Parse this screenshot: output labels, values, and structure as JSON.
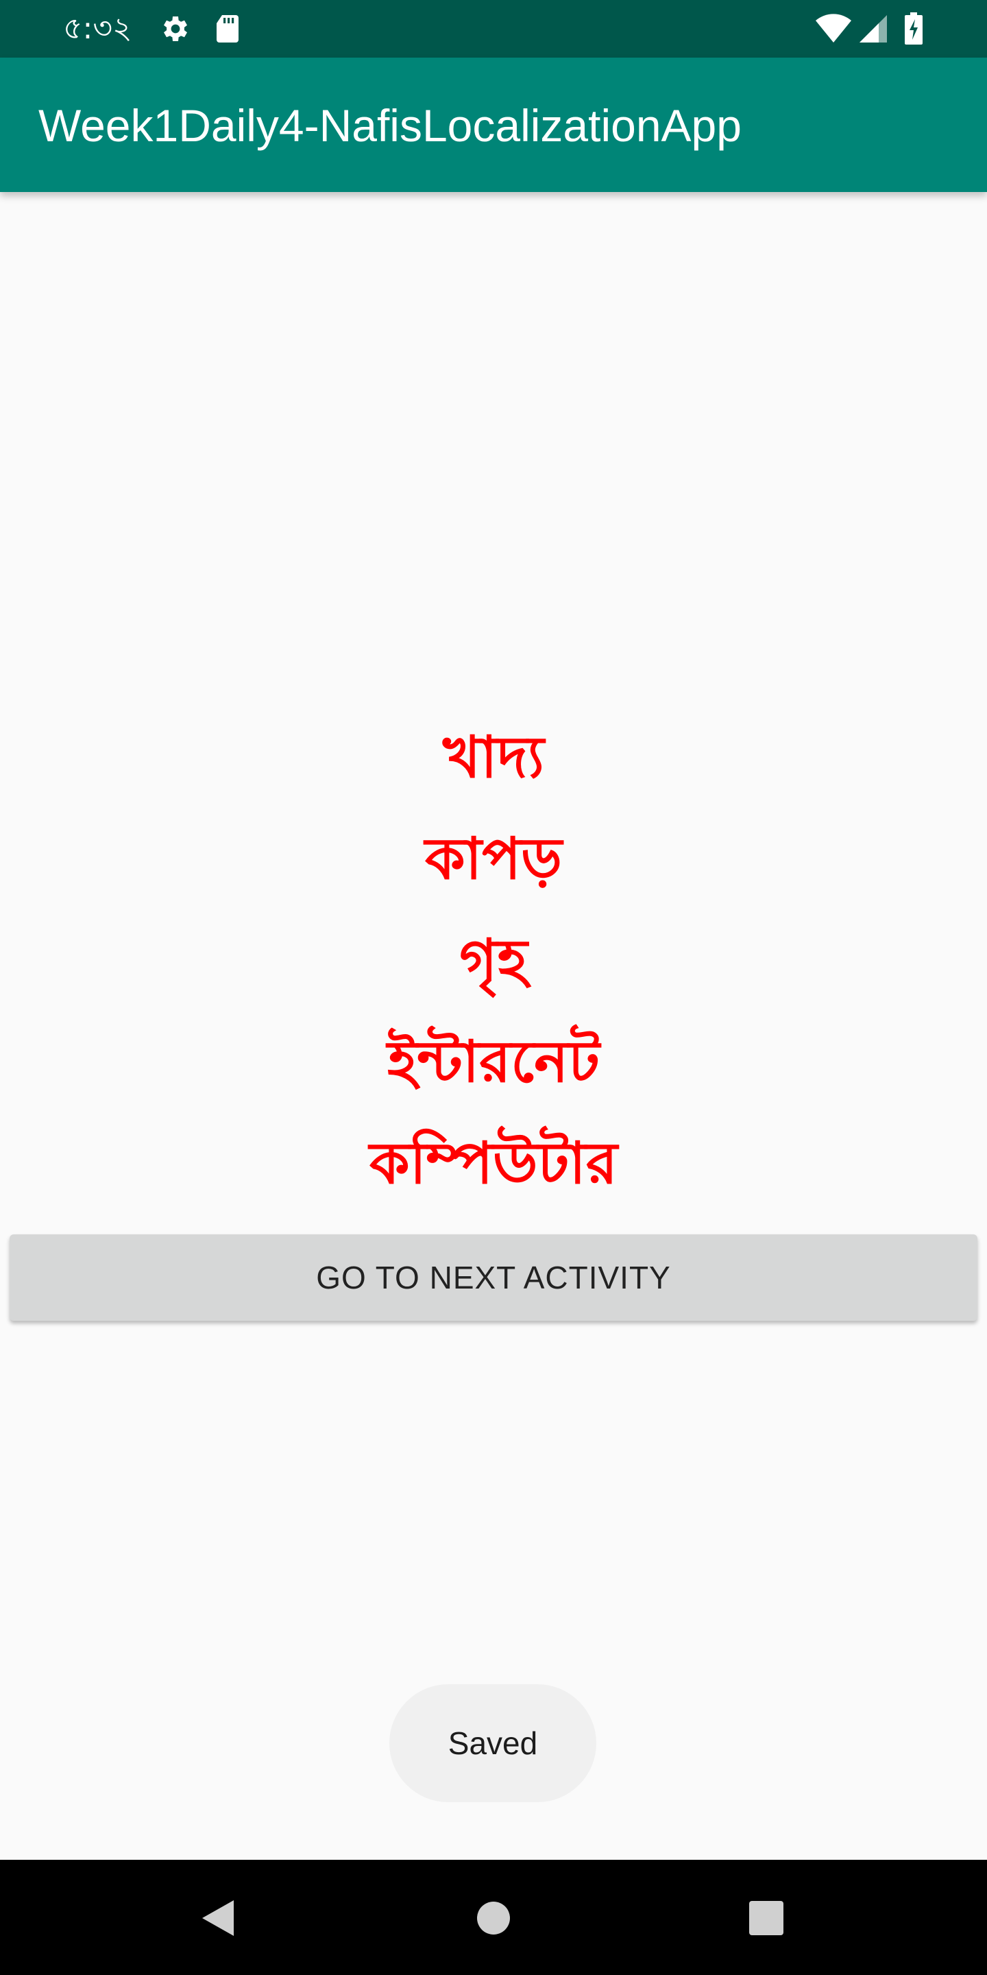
{
  "status_bar": {
    "time": "৫:৩২",
    "icons": [
      "settings-icon",
      "sd-card-icon",
      "wifi-icon",
      "signal-icon",
      "battery-charging-icon"
    ]
  },
  "app_bar": {
    "title": "Week1Daily4-NafisLocalizationApp"
  },
  "main": {
    "words": [
      "খাদ্য",
      "কাপড়",
      "গৃহ",
      "ইন্টারনেট",
      "কম্পিউটার"
    ],
    "next_button_label": "GO TO NEXT ACTIVITY"
  },
  "toast": {
    "message": "Saved"
  },
  "nav_bar": {
    "icons": [
      "back-icon",
      "home-icon",
      "recents-icon"
    ]
  },
  "colors": {
    "status_bar": "#00574B",
    "app_bar": "#008577",
    "word_text": "#FF0000",
    "button_bg": "#D6D7D7"
  }
}
